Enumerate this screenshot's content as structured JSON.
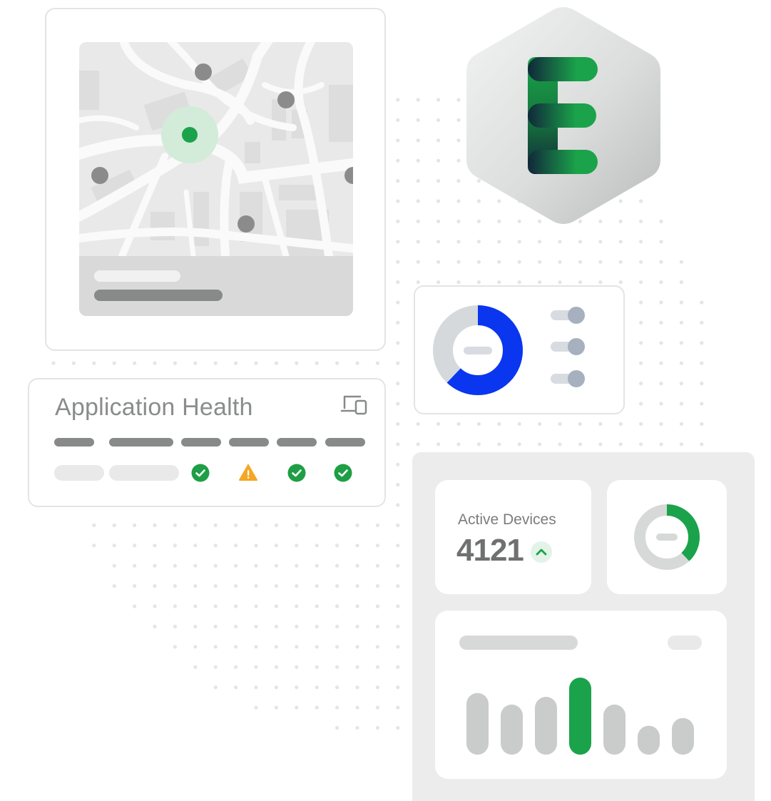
{
  "health_card": {
    "title": "Application Health",
    "device_icon": "devices-icon",
    "statuses": [
      {
        "icon": "check-circle-icon",
        "color": "#1e9e45"
      },
      {
        "icon": "warning-triangle-icon",
        "color": "#f5a623"
      },
      {
        "icon": "check-circle-icon",
        "color": "#1e9e45"
      },
      {
        "icon": "check-circle-icon",
        "color": "#1e9e45"
      }
    ]
  },
  "map_card": {
    "close_icon": "close-icon",
    "close_glyph": "✕"
  },
  "logo": {
    "letter": "E",
    "colors": {
      "green": "#1aa34a",
      "dark": "#11273a",
      "hex_bg": "#dcdedd"
    }
  },
  "settings_card": {
    "donut_blue_fraction": 0.62,
    "colors": {
      "blue": "#0a36f0",
      "gray": "#d5d9dc"
    }
  },
  "active_devices": {
    "label": "Active Devices",
    "value": "4121",
    "trend_icon": "chevron-up-icon",
    "trend_glyph": "^"
  },
  "ring_widget": {
    "green_fraction": 0.38,
    "colors": {
      "green": "#1aa34a",
      "gray": "#d7d9d8"
    }
  },
  "bar_chart_widget": {
    "values": [
      3.2,
      2.6,
      3.0,
      4.0,
      2.6,
      1.5,
      1.9
    ],
    "highlight_index": 3,
    "colors": {
      "bar": "#c9cccb",
      "highlight": "#1aa34a"
    }
  },
  "colors": {
    "accent": "#1aa34a",
    "warning": "#f5a623",
    "neutral": "#878a88"
  }
}
